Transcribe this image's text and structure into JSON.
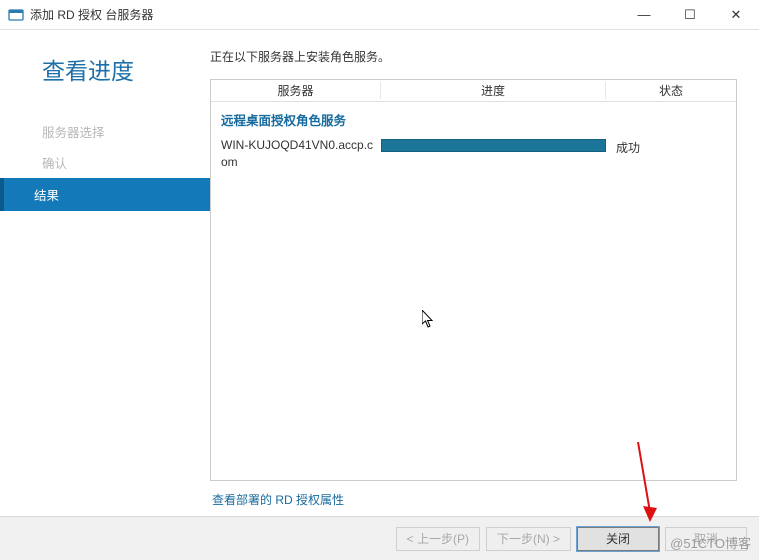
{
  "window": {
    "title": "添加 RD 授权 台服务器",
    "minimize": "—",
    "maximize": "☐",
    "close": "✕"
  },
  "heading": "查看进度",
  "sidebar": {
    "items": [
      {
        "label": "服务器选择"
      },
      {
        "label": "确认"
      },
      {
        "label": "结果"
      }
    ]
  },
  "intro": "正在以下服务器上安装角色服务。",
  "table": {
    "headers": {
      "server": "服务器",
      "progress": "进度",
      "status": "状态"
    },
    "group": "远程桌面授权角色服务",
    "row": {
      "server": "WIN-KUJOQD41VN0.accp.com",
      "status": "成功"
    }
  },
  "link": "查看部署的 RD 授权属性",
  "buttons": {
    "prev": "< 上一步(P)",
    "next": "下一步(N) >",
    "close": "关闭",
    "cancel": "取消"
  },
  "watermark": "@51CTO博客"
}
